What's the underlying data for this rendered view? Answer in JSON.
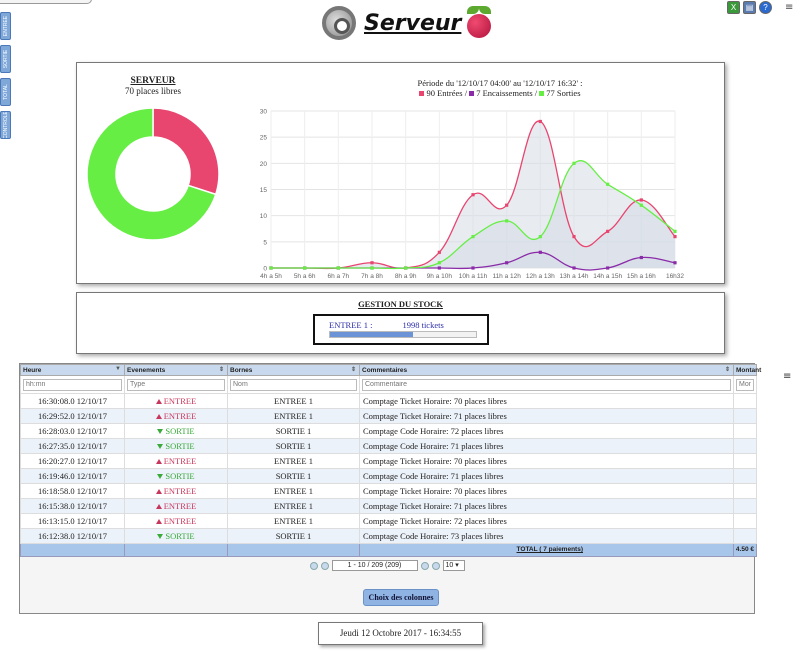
{
  "header": {
    "title": "Serveur"
  },
  "side_tabs": [
    "ENTREE",
    "SORTIE",
    "TOTAL",
    "CONTROLE"
  ],
  "tool_icons": [
    "excel-icon",
    "print-icon",
    "help-icon"
  ],
  "colors": {
    "entrees": "#e8456f",
    "encaissements": "#8a2ba8",
    "sorties": "#66ee44",
    "fill": "#d6dde6"
  },
  "panel1": {
    "pie_title": "SERVEUR",
    "pie_subtitle": "70 places libres",
    "legend_title": "Période du '12/10/17 04:00' au '12/10/17 16:32' :",
    "legend": [
      {
        "label": "90 Entrées",
        "sep": " / "
      },
      {
        "label": "7 Encaissements",
        "sep": " / "
      },
      {
        "label": "77 Sorties",
        "sep": ""
      }
    ]
  },
  "chart_data": [
    {
      "type": "pie",
      "values": [
        30,
        70
      ],
      "colors": [
        "#e8456f",
        "#66ee44"
      ]
    },
    {
      "type": "line",
      "categories": [
        "4h a 5h",
        "5h a 6h",
        "6h a 7h",
        "7h a 8h",
        "8h a 9h",
        "9h a 10h",
        "10h a 11h",
        "11h a 12h",
        "12h a 13h",
        "13h a 14h",
        "14h a 15h",
        "15h a 16h",
        "16h32"
      ],
      "ylim": [
        0,
        30
      ],
      "yticks": [
        0,
        5,
        10,
        15,
        20,
        25,
        30
      ],
      "series": [
        {
          "name": "Entrées",
          "color": "#e8456f",
          "values": [
            0,
            0,
            0,
            1,
            0,
            3,
            14,
            12,
            28,
            6,
            7,
            13,
            6
          ]
        },
        {
          "name": "Encaissements",
          "color": "#8a2ba8",
          "values": [
            0,
            0,
            0,
            0,
            0,
            0,
            0,
            1,
            3,
            0,
            0,
            2,
            1
          ]
        },
        {
          "name": "Sorties",
          "color": "#66ee44",
          "values": [
            0,
            0,
            0,
            0,
            0,
            1,
            6,
            9,
            6,
            20,
            16,
            12,
            7
          ]
        }
      ]
    }
  ],
  "stock": {
    "title": "GESTION DU STOCK",
    "name": "ENTREE 1 :",
    "value": "1998 tickets",
    "level": 0.57
  },
  "table": {
    "columns": [
      "Heure",
      "Evenements",
      "Bornes",
      "Commentaires",
      "Montant"
    ],
    "filters": [
      "hh:mn",
      "Type",
      "Nom",
      "Commentaire",
      "Montant"
    ],
    "rows": [
      {
        "heure": "16:30:08.0 12/10/17",
        "ev": "ENTREE",
        "borne": "ENTREE 1",
        "comment": "Comptage Ticket Horaire: 70 places libres"
      },
      {
        "heure": "16:29:52.0 12/10/17",
        "ev": "ENTREE",
        "borne": "ENTREE 1",
        "comment": "Comptage Ticket Horaire: 71 places libres"
      },
      {
        "heure": "16:28:03.0 12/10/17",
        "ev": "SORTIE",
        "borne": "SORTIE 1",
        "comment": "Comptage Code Horaire: 72 places libres"
      },
      {
        "heure": "16:27:35.0 12/10/17",
        "ev": "SORTIE",
        "borne": "SORTIE 1",
        "comment": "Comptage Code Horaire: 71 places libres"
      },
      {
        "heure": "16:20:27.0 12/10/17",
        "ev": "ENTREE",
        "borne": "ENTREE 1",
        "comment": "Comptage Ticket Horaire: 70 places libres"
      },
      {
        "heure": "16:19:46.0 12/10/17",
        "ev": "SORTIE",
        "borne": "SORTIE 1",
        "comment": "Comptage Code Horaire: 71 places libres"
      },
      {
        "heure": "16:18:58.0 12/10/17",
        "ev": "ENTREE",
        "borne": "ENTREE 1",
        "comment": "Comptage Ticket Horaire: 70 places libres"
      },
      {
        "heure": "16:15:38.0 12/10/17",
        "ev": "ENTREE",
        "borne": "ENTREE 1",
        "comment": "Comptage Ticket Horaire: 71 places libres"
      },
      {
        "heure": "16:13:15.0 12/10/17",
        "ev": "ENTREE",
        "borne": "ENTREE 1",
        "comment": "Comptage Ticket Horaire: 72 places libres"
      },
      {
        "heure": "16:12:38.0 12/10/17",
        "ev": "SORTIE",
        "borne": "SORTIE 1",
        "comment": "Comptage Code Horaire: 73 places libres"
      }
    ],
    "total_label": "TOTAL ( 7 paiements)",
    "total_value": "4.50 €",
    "pager_text": "1 - 10 / 209 (209)",
    "page_size": "10",
    "columns_button": "Choix des colonnes"
  },
  "footer": {
    "date": "Jeudi 12 Octobre 2017 - 16:34:55"
  }
}
